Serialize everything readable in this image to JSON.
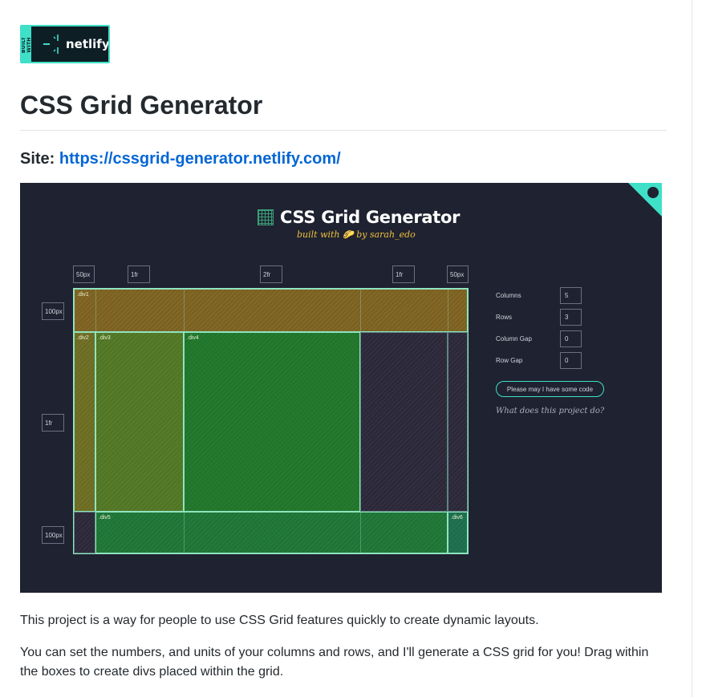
{
  "badge": {
    "side_text": "BUILT WITH",
    "logo_text": "netlify",
    "icon": "netlify-logo-icon"
  },
  "page": {
    "title": "CSS Grid Generator",
    "site_label": "Site:",
    "site_url": "https://cssgrid-generator.netlify.com/"
  },
  "screenshot": {
    "title": "CSS Grid Generator",
    "subtitle": "built with 🌮 by sarah_edo",
    "columns": [
      "50px",
      "1fr",
      "2fr",
      "1fr",
      "50px"
    ],
    "rows": [
      "100px",
      "1fr",
      "100px"
    ],
    "divs": [
      ".div1",
      ".div2",
      ".div3",
      ".div4",
      ".div5",
      ".div6"
    ],
    "controls": [
      {
        "label": "Columns",
        "value": "5"
      },
      {
        "label": "Rows",
        "value": "3"
      },
      {
        "label": "Column Gap",
        "value": "0"
      },
      {
        "label": "Row Gap",
        "value": "0"
      }
    ],
    "button": "Please may I have some code",
    "question": "What does this project do?",
    "accent": "#3fe0c8"
  },
  "body": {
    "p1": "This project is a way for people to use CSS Grid features quickly to create dynamic layouts.",
    "p2": "You can set the numbers, and units of your columns and rows, and I'll generate a CSS grid for you! Drag within the boxes to create divs placed within the grid."
  }
}
